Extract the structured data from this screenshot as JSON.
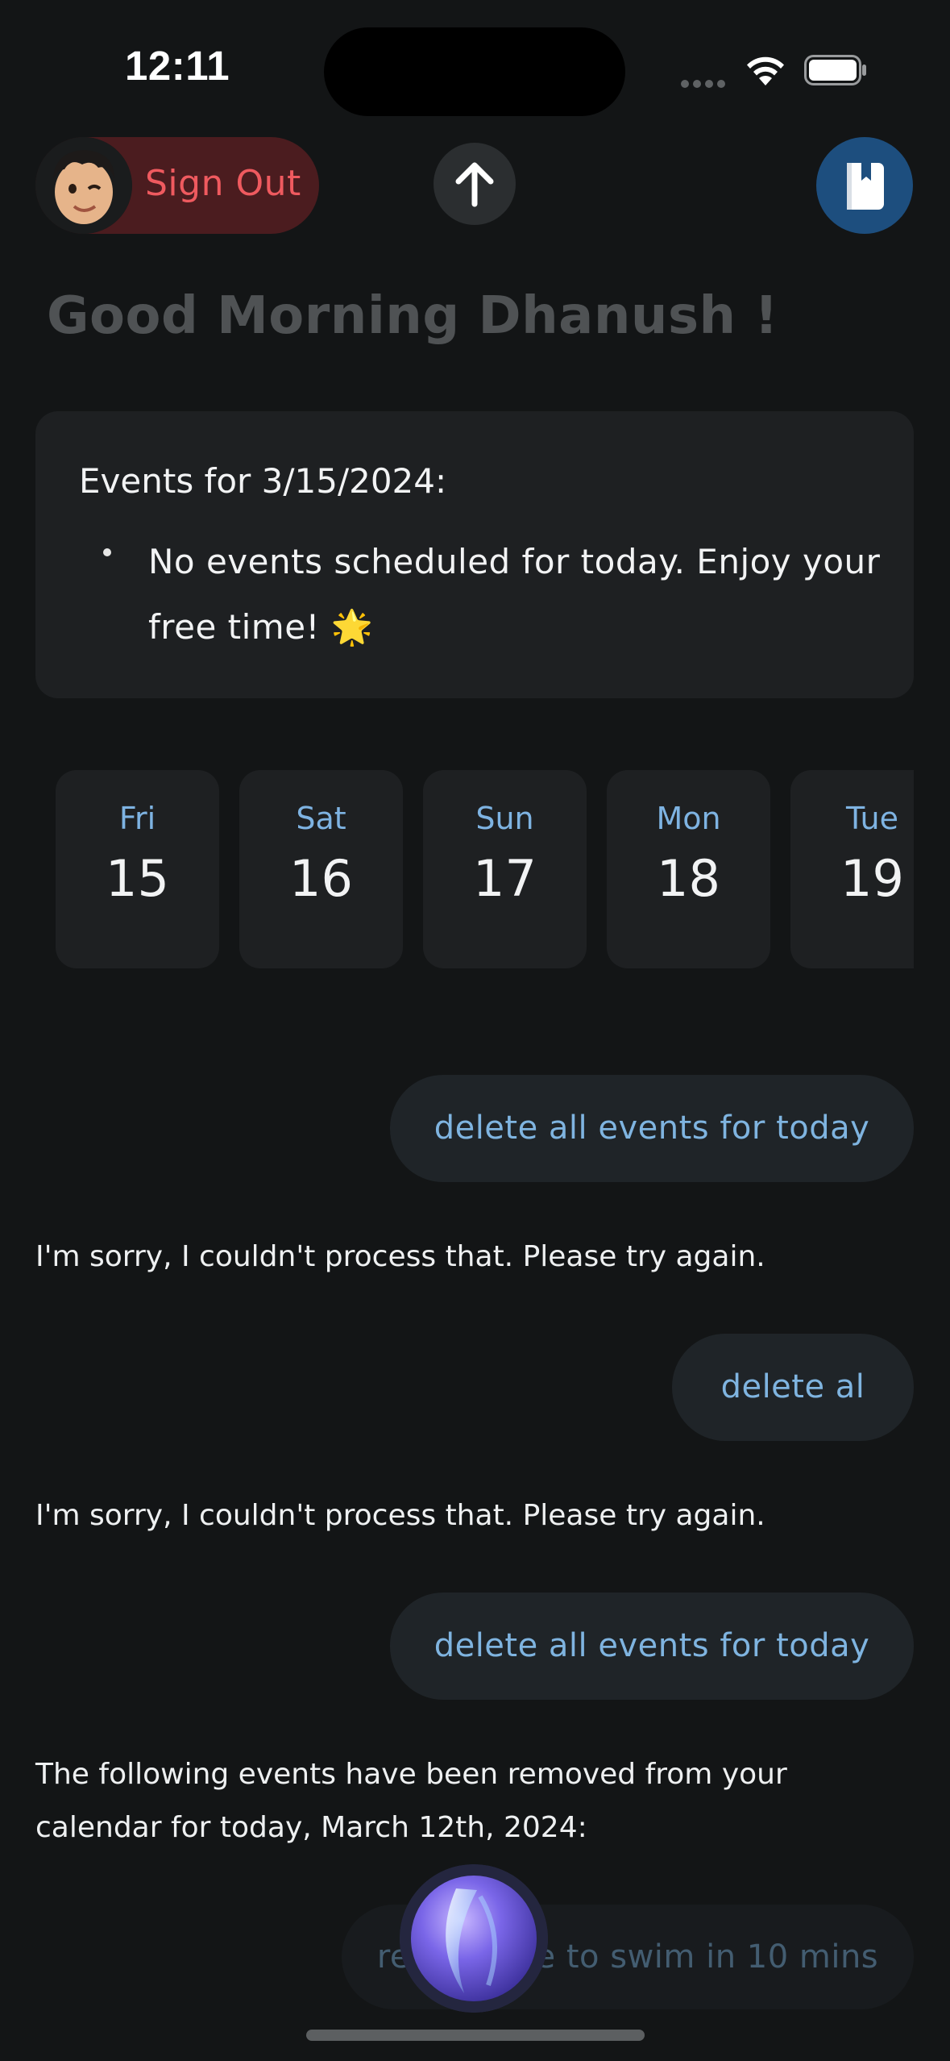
{
  "status_bar": {
    "time": "12:11"
  },
  "header": {
    "sign_out_label": "Sign Out",
    "greeting": "Good Morning Dhanush !"
  },
  "events_card": {
    "title": "Events for 3/15/2024:",
    "items": [
      "No events scheduled for today. Enjoy your free time! 🌟"
    ]
  },
  "dates": [
    {
      "day": "Fri",
      "num": "15"
    },
    {
      "day": "Sat",
      "num": "16"
    },
    {
      "day": "Sun",
      "num": "17"
    },
    {
      "day": "Mon",
      "num": "18"
    },
    {
      "day": "Tue",
      "num": "19"
    }
  ],
  "chat": {
    "messages": [
      {
        "role": "user",
        "text": "delete all events for today"
      },
      {
        "role": "assistant",
        "text": "I'm sorry, I couldn't process that. Please try again."
      },
      {
        "role": "user",
        "text": "delete al"
      },
      {
        "role": "assistant",
        "text": "I'm sorry, I couldn't process that. Please try again."
      },
      {
        "role": "user",
        "text": "delete all events for today"
      },
      {
        "role": "assistant",
        "text": "The following events have been removed from your calendar for today, March 12th, 2024:"
      },
      {
        "role": "user",
        "text": "remind me to swim in 10 mins"
      }
    ]
  },
  "colors": {
    "background": "#131516",
    "card": "#1e2022",
    "accent_blue": "#7fb4e0",
    "sign_out_red": "#ef5a5f",
    "book_button": "#1d4e7e"
  },
  "icons": {
    "up_button": "arrow-up-icon",
    "book_button": "book-icon",
    "assistant_orb": "siri-orb-icon"
  }
}
